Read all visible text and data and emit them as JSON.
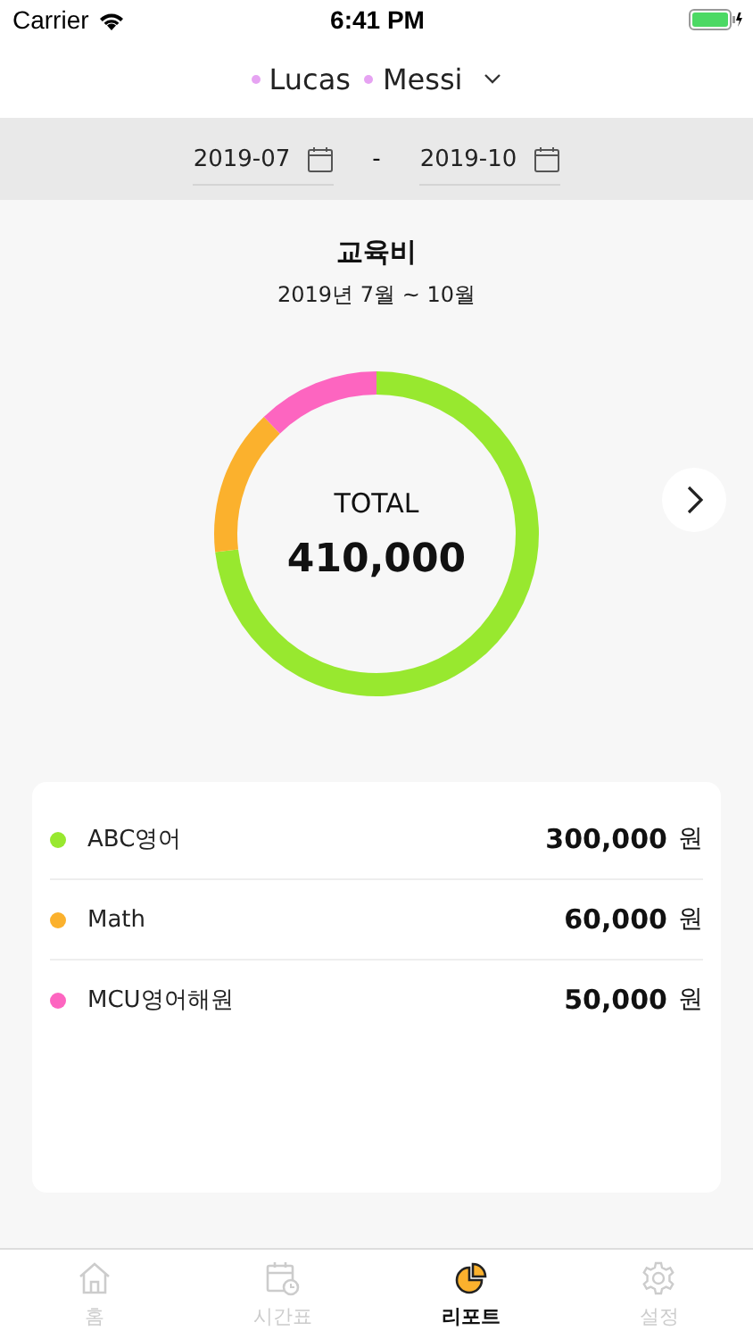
{
  "status_bar": {
    "carrier": "Carrier",
    "time": "6:41 PM"
  },
  "header": {
    "members": [
      {
        "name": "Lucas",
        "color": "#e6a3f2"
      },
      {
        "name": "Messi",
        "color": "#e6a3f2"
      }
    ]
  },
  "date_range": {
    "start": "2019-07",
    "separator": "-",
    "end": "2019-10"
  },
  "report": {
    "title": "교육비",
    "period": "2019년 7월 ~ 10월",
    "total_label": "TOTAL",
    "total": "410,000",
    "chart_data": {
      "type": "donut",
      "values": [
        73.2,
        14.6,
        12.2
      ]
    }
  },
  "items": [
    {
      "name": "ABC영어",
      "amount": "300,000",
      "unit": "원",
      "color": "#98e82f"
    },
    {
      "name": "Math",
      "amount": "60,000",
      "unit": "원",
      "color": "#fbb12d"
    },
    {
      "name": "MCU영어해원",
      "amount": "50,000",
      "unit": "원",
      "color": "#fd65c0"
    }
  ],
  "tabs": [
    {
      "label": "홈",
      "selected": false
    },
    {
      "label": "시간표",
      "selected": false
    },
    {
      "label": "리포트",
      "selected": true
    },
    {
      "label": "설정",
      "selected": false
    }
  ]
}
